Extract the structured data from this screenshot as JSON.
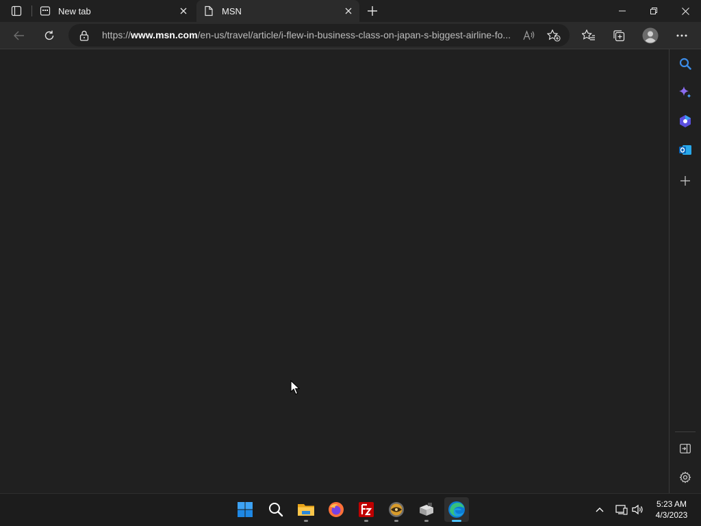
{
  "browser": {
    "tabs": [
      {
        "label": "New tab",
        "icon": "newtab-page-icon",
        "active": false
      },
      {
        "label": "MSN",
        "icon": "document-icon",
        "active": true
      }
    ],
    "url": {
      "prefix": "https://",
      "domain": "www.msn.com",
      "path": "/en-us/travel/article/i-flew-in-business-class-on-japan-s-biggest-airline-fo..."
    },
    "toolbar_icons": [
      "back-icon",
      "reload-icon",
      "lock-icon",
      "read-aloud-icon",
      "add-favorite-icon",
      "favorites-icon",
      "collections-icon",
      "profile-icon",
      "more-icon"
    ]
  },
  "sidebar": {
    "icons": [
      "search-icon",
      "copilot-sparkle-icon",
      "shopping-icon",
      "outlook-icon",
      "add-icon",
      "hide-sidebar-icon",
      "settings-icon"
    ]
  },
  "taskbar": {
    "apps": [
      "start-icon",
      "search-icon",
      "file-explorer-icon",
      "firefox-icon",
      "filezilla-icon",
      "media-app-icon",
      "package-app-icon",
      "edge-icon"
    ],
    "time": "5:23 AM",
    "date": "4/3/2023"
  },
  "colors": {
    "accent": "#4cc2ff",
    "background": "#202020",
    "toolbar": "#2b2b2b"
  }
}
